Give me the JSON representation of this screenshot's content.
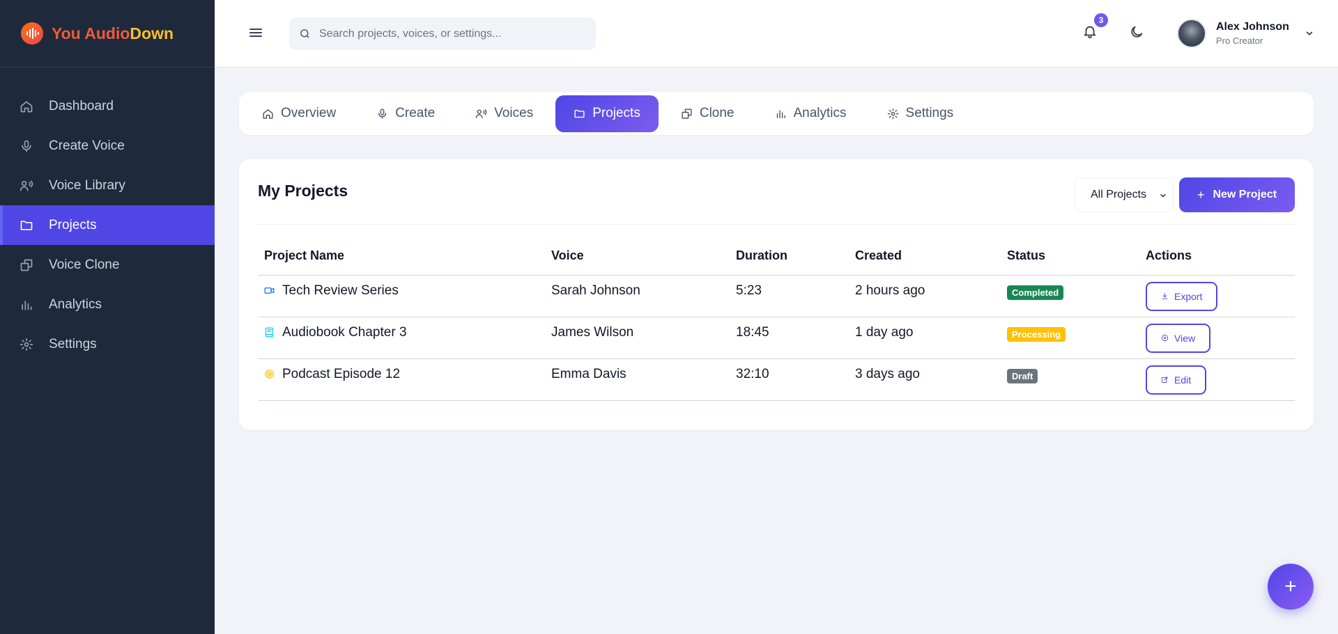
{
  "brand": {
    "name_part1": "You Audio",
    "name_part2": "Down",
    "color1": "#f05a3c",
    "color2": "#fbbf24",
    "logo_icon": "soundwave-icon"
  },
  "sidebar": {
    "items": [
      {
        "label": "Dashboard",
        "icon": "home-icon",
        "active": false
      },
      {
        "label": "Create Voice",
        "icon": "microphone-icon",
        "active": false
      },
      {
        "label": "Voice Library",
        "icon": "voices-icon",
        "active": false
      },
      {
        "label": "Projects",
        "icon": "folder-icon",
        "active": true
      },
      {
        "label": "Voice Clone",
        "icon": "clone-icon",
        "active": false
      },
      {
        "label": "Analytics",
        "icon": "bar-chart-icon",
        "active": false
      },
      {
        "label": "Settings",
        "icon": "gear-icon",
        "active": false
      }
    ]
  },
  "header": {
    "search_placeholder": "Search projects, voices, or settings...",
    "notification_count": "3",
    "user": {
      "name": "Alex Johnson",
      "role": "Pro Creator"
    }
  },
  "tabs": [
    {
      "label": "Overview",
      "icon": "home-icon",
      "active": false
    },
    {
      "label": "Create",
      "icon": "microphone-icon",
      "active": false
    },
    {
      "label": "Voices",
      "icon": "voices-icon",
      "active": false
    },
    {
      "label": "Projects",
      "icon": "folder-icon",
      "active": true
    },
    {
      "label": "Clone",
      "icon": "clone-icon",
      "active": false
    },
    {
      "label": "Analytics",
      "icon": "bar-chart-icon",
      "active": false
    },
    {
      "label": "Settings",
      "icon": "gear-icon",
      "active": false
    }
  ],
  "projects": {
    "title": "My Projects",
    "filter_selected": "All Projects",
    "new_button": "New Project",
    "columns": [
      "Project Name",
      "Voice",
      "Duration",
      "Created",
      "Status",
      "Actions"
    ],
    "rows": [
      {
        "name": "Tech Review Series",
        "icon": "video-icon",
        "voice": "Sarah Johnson",
        "duration": "5:23",
        "created": "2 hours ago",
        "status": "Completed",
        "status_color": "#198754",
        "action": "Export",
        "action_icon": "download-icon"
      },
      {
        "name": "Audiobook Chapter 3",
        "icon": "book-icon",
        "voice": "James Wilson",
        "duration": "18:45",
        "created": "1 day ago",
        "status": "Processing",
        "status_color": "#ffc107",
        "action": "View",
        "action_icon": "eye-icon"
      },
      {
        "name": "Podcast Episode 12",
        "icon": "podcast-icon",
        "voice": "Emma Davis",
        "duration": "32:10",
        "created": "3 days ago",
        "status": "Draft",
        "status_color": "#6c757d",
        "action": "Edit",
        "action_icon": "edit-icon"
      }
    ]
  },
  "colors": {
    "accent": "#4f46e5",
    "sidebar_bg": "#1e293b",
    "page_bg": "#f1f3f8"
  }
}
